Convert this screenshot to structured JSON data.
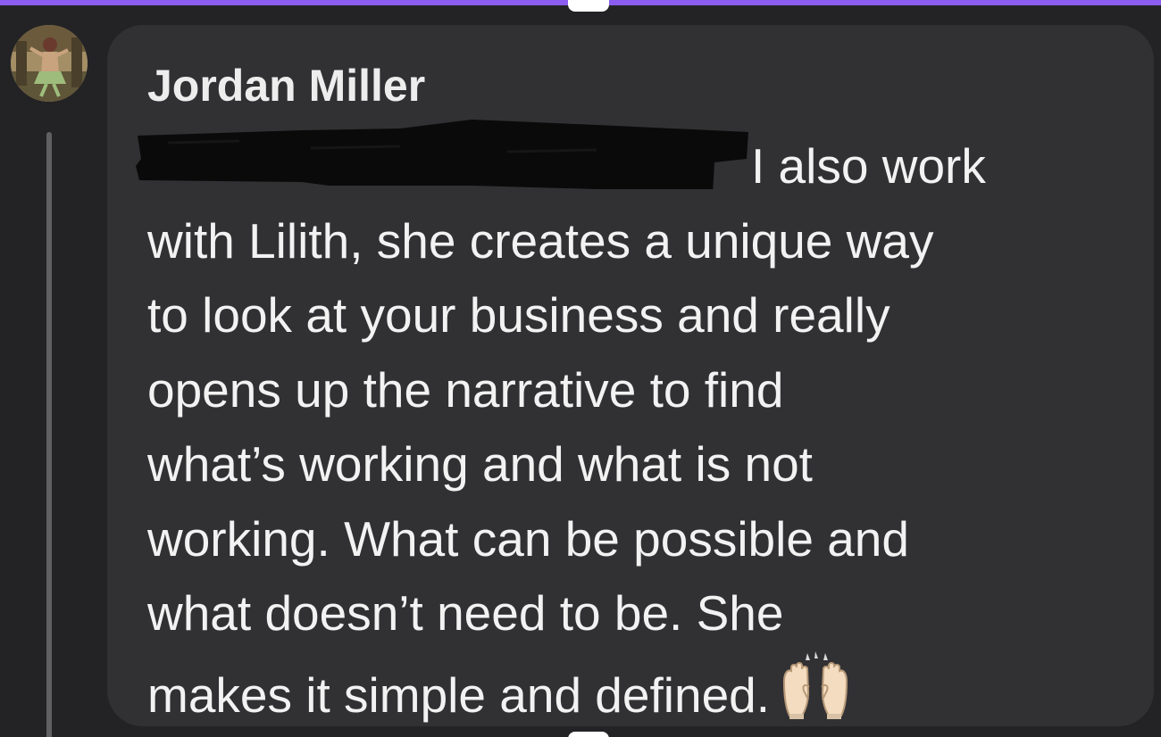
{
  "colors": {
    "page_background": "#232325",
    "bubble_background": "#313134",
    "accent_bar": "#8a5cf0",
    "text": "#f2f2f2",
    "redaction": "#0a0a0a"
  },
  "comment": {
    "author": "Jordan Miller",
    "avatar_icon": "avatar-photo-icon",
    "lines": [
      "I also work",
      "with Lilith, she creates a unique way",
      "to look at your business and really",
      "opens up the narrative to find",
      "what’s working and what is not",
      "working. What can be possible and",
      "what doesn’t need to be. She",
      "makes it simple and defined."
    ],
    "emoji_icon": "raising-hands-emoji-icon",
    "redaction_icon": "redaction-marker-icon"
  }
}
